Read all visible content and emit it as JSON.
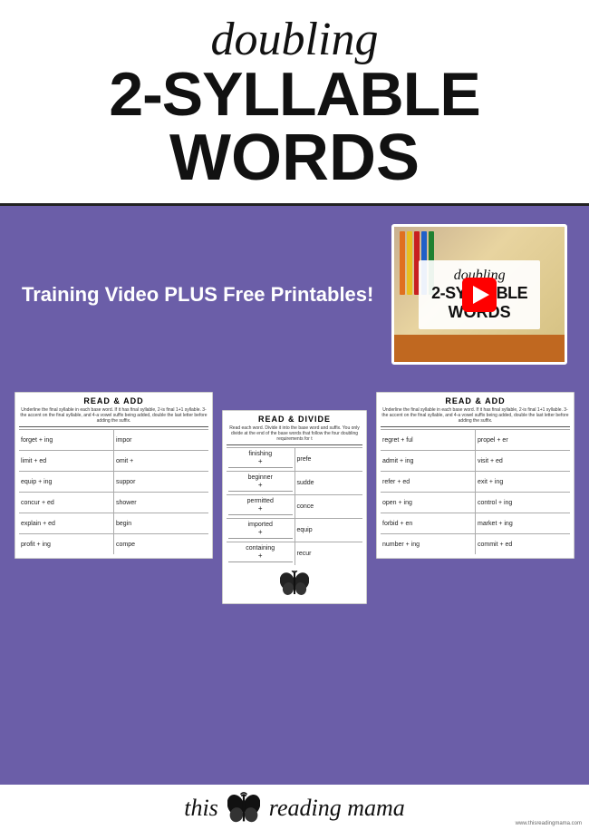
{
  "header": {
    "title_cursive": "doubling",
    "title_line2": "2-SYLLABLE",
    "title_line3": "WORDS"
  },
  "purple_section": {
    "training_text": "Training Video PLUS Free Printables!",
    "video": {
      "title_cursive": "doubling",
      "title_line2": "2-SYLLABLE",
      "title_line3": "WORDS"
    }
  },
  "worksheets": {
    "left": {
      "title": "READ & ADD",
      "subtitle": "Underline the final syllable in each base word. If it has final syllable, 2-is final 1+1 syllable. 3-the accent on the final syllable, and 4-a vowel suffix being added, double the last letter before adding the suffix.",
      "rows": [
        [
          "forget + ing",
          "impor"
        ],
        [
          "limit + ed",
          "omit +"
        ],
        [
          "equip + ing",
          "suppor"
        ],
        [
          "concur + ed",
          "shower"
        ],
        [
          "explain + ed",
          "begin"
        ],
        [
          "profit + ing",
          "compe"
        ]
      ]
    },
    "middle": {
      "title": "READ & DIVIDE",
      "subtitle": "Read each word. Divide it into the base word and suffix. You only divide at the end of the base words that follow the four doubling requirements for t",
      "words": [
        "finishing",
        "beginner",
        "permitted",
        "imported",
        "containing"
      ],
      "right_col": [
        "prefe",
        "sudde",
        "conce",
        "equip",
        "recur"
      ]
    },
    "right": {
      "title": "READ & ADD",
      "subtitle": "Underline the final syllable in each base word. If it has final syllable, 2-is final 1+1 syllable. 3-the accent on the final syllable, and 4-a vowel suffix being added, double the last letter before adding the suffix.",
      "rows": [
        [
          "regret + ful",
          "propel + er"
        ],
        [
          "admit + ing",
          "visit + ed"
        ],
        [
          "refer + ed",
          "exit + ing"
        ],
        [
          "open + ing",
          "control + ing"
        ],
        [
          "forbid + en",
          "market + ing"
        ],
        [
          "number + ing",
          "commit + ed"
        ]
      ]
    }
  },
  "branding": {
    "text_left": "this",
    "text_right": "reading mama",
    "url": "www.thisreadingmama.com"
  }
}
